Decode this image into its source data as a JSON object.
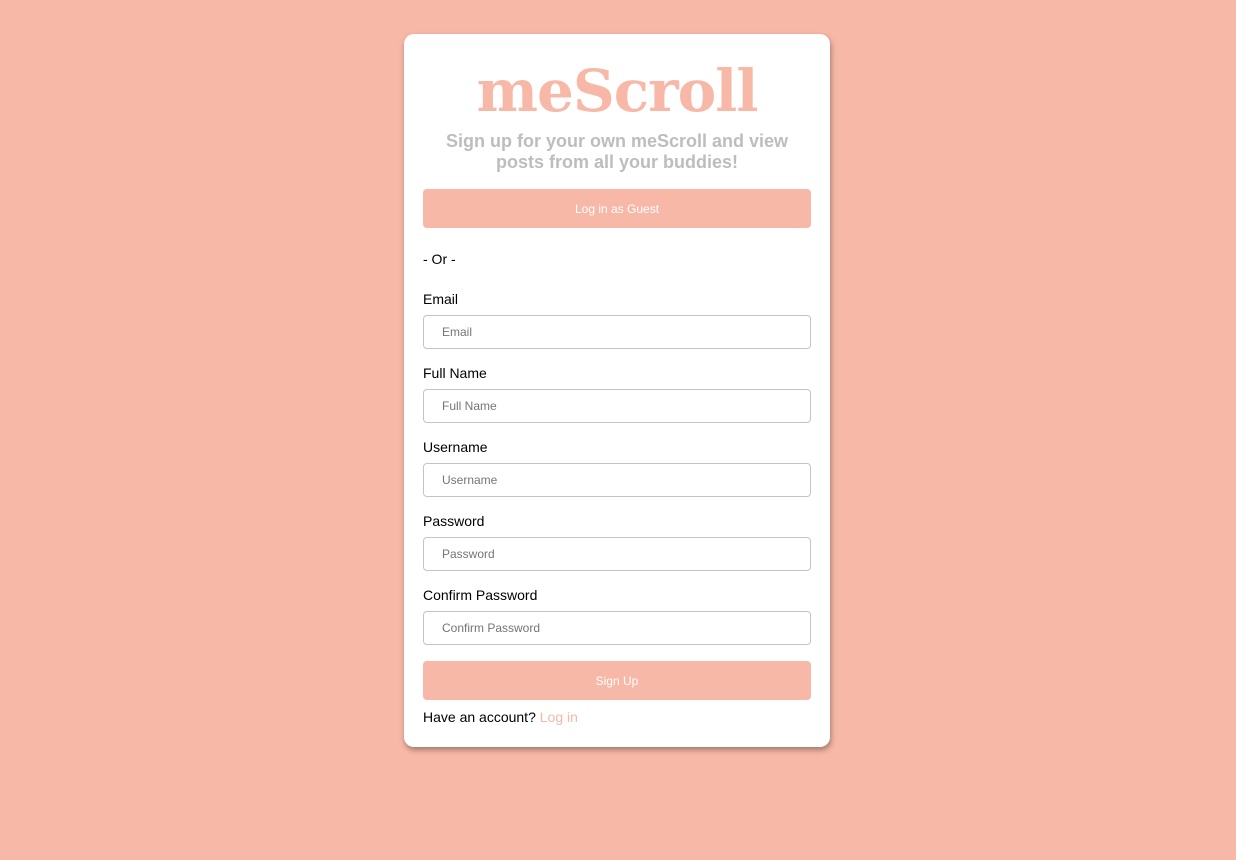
{
  "app": {
    "logo_text": "meScroll",
    "tagline": "Sign up for your own meScroll and view posts from all your buddies!"
  },
  "guest_button_label": "Log in as Guest",
  "separator_text": "- Or -",
  "fields": [
    {
      "label": "Email",
      "placeholder": "Email",
      "value": ""
    },
    {
      "label": "Full Name",
      "placeholder": "Full Name",
      "value": ""
    },
    {
      "label": "Username",
      "placeholder": "Username",
      "value": ""
    },
    {
      "label": "Password",
      "placeholder": "Password",
      "value": ""
    },
    {
      "label": "Confirm Password",
      "placeholder": "Confirm Password",
      "value": ""
    }
  ],
  "signup_button_label": "Sign Up",
  "login_prompt": {
    "text": "Have an account?",
    "link_text": "Log in"
  },
  "colors": {
    "background": "#f7b8a7",
    "accent": "#f7b8a7",
    "tagline": "#bdbdbd"
  }
}
